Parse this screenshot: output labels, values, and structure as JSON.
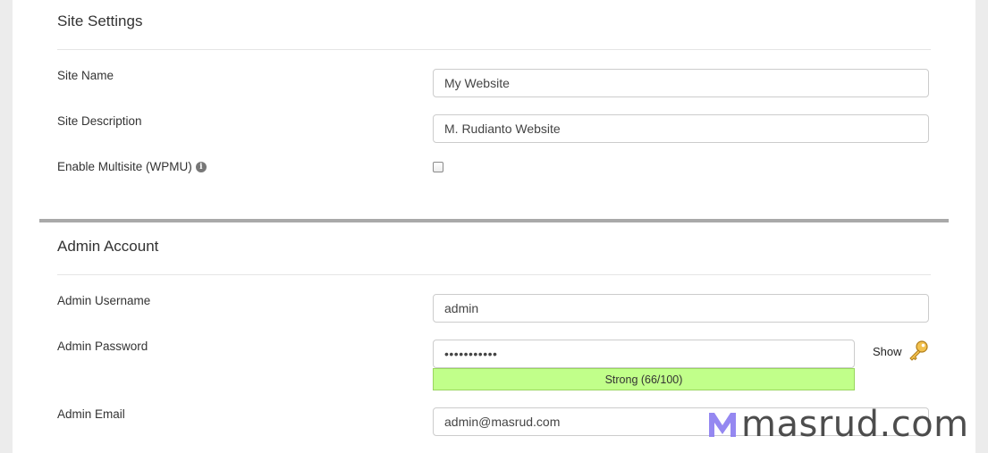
{
  "site_settings": {
    "title": "Site Settings",
    "site_name": {
      "label": "Site Name",
      "value": "My Website"
    },
    "site_description": {
      "label": "Site Description",
      "value": "M. Rudianto Website"
    },
    "multisite": {
      "label": "Enable Multisite (WPMU)",
      "info_icon": "info-icon",
      "checked": false
    }
  },
  "admin_account": {
    "title": "Admin Account",
    "username": {
      "label": "Admin Username",
      "value": "admin"
    },
    "password": {
      "label": "Admin Password",
      "value": "•••••••••••",
      "show_label": "Show",
      "generate_icon": "key-icon",
      "strength_text": "Strong (66/100)",
      "strength_score": 66,
      "strength_color": "#c1ff8a"
    },
    "email": {
      "label": "Admin Email",
      "value": "admin@masrud.com"
    }
  },
  "watermark": {
    "text": "masrud.com",
    "logo_color": "#8a7cf0"
  }
}
